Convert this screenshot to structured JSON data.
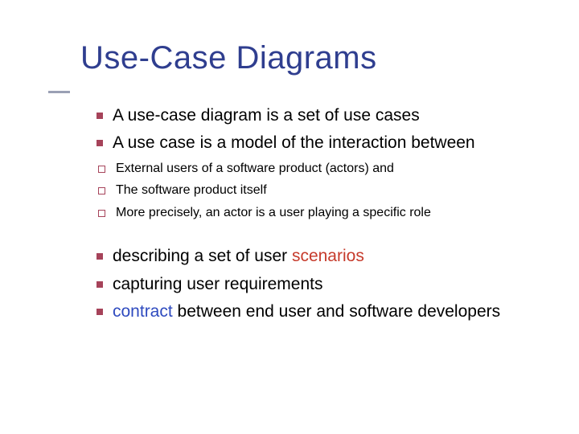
{
  "title": "Use-Case Diagrams",
  "bullets": {
    "b1": "A use-case diagram is a set of use cases",
    "b2": "A use case is a model of the interaction between",
    "b2a": "External users of a software product (actors) and",
    "b2b": "The software product itself",
    "b2c": "More precisely, an actor is a user playing a specific role",
    "b3_pre": "describing a set of user ",
    "b3_em": "scenarios",
    "b4": "capturing user requirements",
    "b5_em": "contract",
    "b5_post": " between end user and software developers"
  }
}
